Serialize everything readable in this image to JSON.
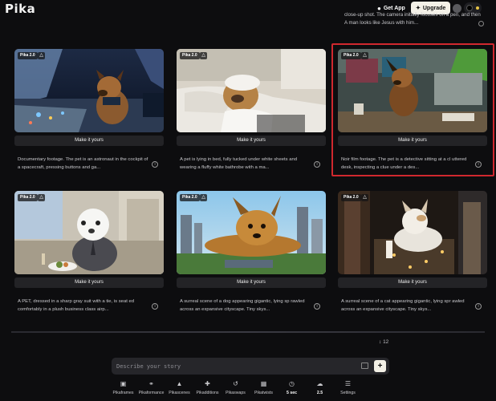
{
  "header": {
    "logo": "Pika",
    "get_app": "Get App",
    "upgrade": "Upgrade"
  },
  "top_partial": {
    "text": "close-up shot. The camera initially focuses on a pen, and then A man looks like Jesus with him..."
  },
  "cards": [
    {
      "badge": "Pika 2.0",
      "button": "Make it yours",
      "desc": "Documentary footage. The pet is an astronaut in the cockpit of a spacecraft, pressing buttons and ga..."
    },
    {
      "badge": "Pika 2.0",
      "button": "Make it yours",
      "desc": "A pet is lying in bed, fully tucked under white sheets and wearing a fluffy white bathrobe with a ma..."
    },
    {
      "badge": "Pika 2.0",
      "button": "Make it yours",
      "desc": "Noir film footage. The pet is a detective sitting at a cl uttered desk, inspecting a clue under a des..."
    },
    {
      "badge": "Pika 2.0",
      "button": "Make it yours",
      "desc": "A PET, dressed in a sharp gray suit with a tie, is seat ed comfortably in a plush business class airp..."
    },
    {
      "badge": "Pika 2.0",
      "button": "Make it yours",
      "desc": "A surreal scene of a dog appearing gigantic, lying sp rawled across an expansive cityscape. Tiny skys..."
    },
    {
      "badge": "Pika 2.0",
      "button": "Make it yours",
      "desc": "A surreal scene of a cat appearing gigantic, lying spr awled across an expansive cityscape. Tiny skys..."
    }
  ],
  "count": "12",
  "prompt": {
    "placeholder": "Describe your story"
  },
  "toolbar": [
    {
      "label": "Pikaframes",
      "icon": "frames-icon"
    },
    {
      "label": "Pikaformance",
      "icon": "performance-icon"
    },
    {
      "label": "Pikascenes",
      "icon": "scenes-icon"
    },
    {
      "label": "Pikadditions",
      "icon": "additions-icon"
    },
    {
      "label": "Pikaswaps",
      "icon": "swaps-icon"
    },
    {
      "label": "Pikatwists",
      "icon": "twists-icon"
    },
    {
      "label": "5 sec",
      "icon": "clock-icon"
    },
    {
      "label": "2.5",
      "icon": "model-icon"
    },
    {
      "label": "Settings",
      "icon": "settings-icon"
    }
  ],
  "colors": {
    "background": "#0d0d0f",
    "card_button": "#232326",
    "highlight": "#d0282e",
    "upgrade_bg": "#f4f1e8"
  }
}
